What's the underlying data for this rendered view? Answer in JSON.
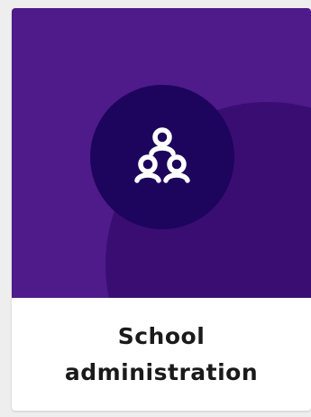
{
  "card": {
    "title_line1": "School",
    "title_line2": "administration",
    "icon": "people-group-icon",
    "colors": {
      "banner": "#4f1a8a",
      "banner_shape": "#3a0d72",
      "icon_circle": "#1d045c",
      "icon": "#ffffff",
      "label_text": "#1a1a1a",
      "card_bg": "#ffffff",
      "page_bg": "#eeeeee"
    }
  }
}
